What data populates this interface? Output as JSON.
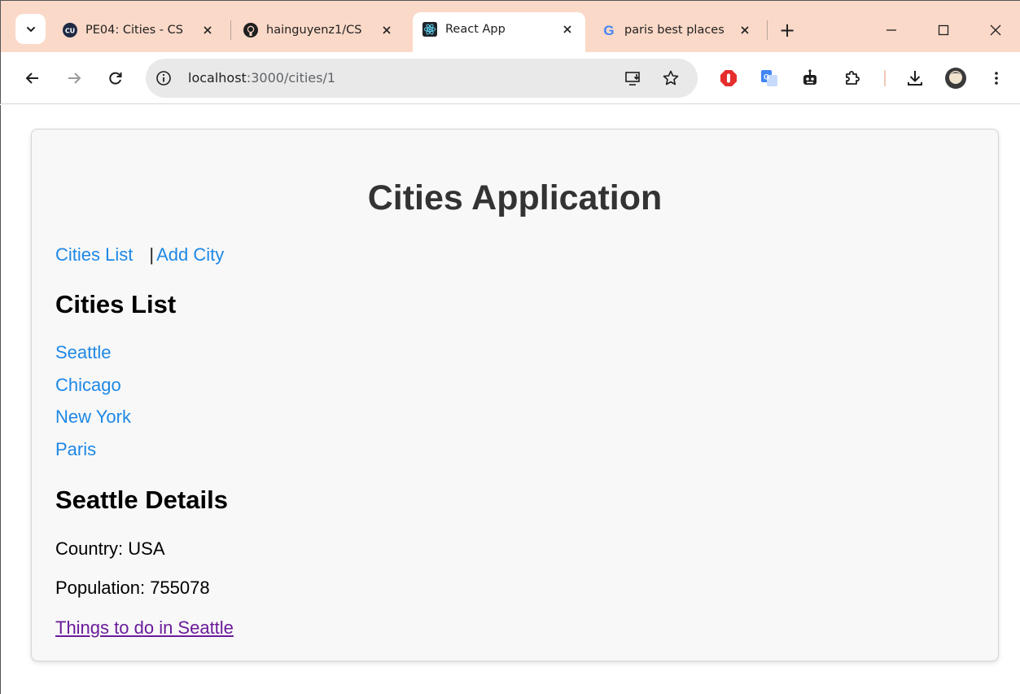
{
  "browser": {
    "tabs": [
      {
        "title": "PE04: Cities - CS",
        "favicon": "cu-icon",
        "active": false
      },
      {
        "title": "hainguyenz1/CS",
        "favicon": "github-icon",
        "active": false
      },
      {
        "title": "React App",
        "favicon": "react-icon",
        "active": true
      },
      {
        "title": "paris best places",
        "favicon": "google-icon",
        "active": false
      }
    ],
    "new_tab_symbol": "+",
    "address": {
      "host": "localhost",
      "path": ":3000/cities/1"
    }
  },
  "app": {
    "title": "Cities Application",
    "nav": {
      "cities_list": "Cities List",
      "divider": "|",
      "add_city": "Add City"
    },
    "list_heading": "Cities List",
    "cities": [
      "Seattle",
      "Chicago",
      "New York",
      "Paris"
    ],
    "details": {
      "heading": "Seattle Details",
      "country": "Country: USA",
      "population": "Population: 755078",
      "link": "Things to do in Seattle"
    }
  },
  "colors": {
    "link": "#1e88e5",
    "visited_link": "#6a1b9a",
    "title": "#333333",
    "tabstrip": "#fbd9c8",
    "card_bg": "#f8f8f8"
  }
}
